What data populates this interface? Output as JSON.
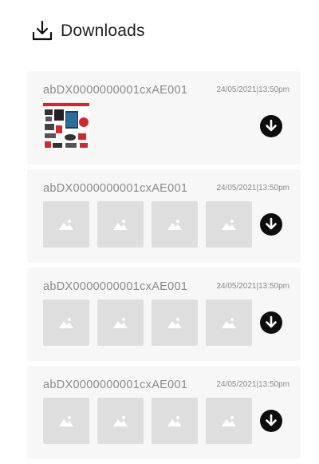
{
  "header": {
    "title": "Downloads",
    "icon": "download-tray-icon"
  },
  "cards": [
    {
      "id": "abDX0000000001cxAE001",
      "date": "24/05/2021|13:50pm",
      "thumbs": [
        "product-flyer-image"
      ]
    },
    {
      "id": "abDX0000000001cxAE001",
      "date": "24/05/2021|13:50pm",
      "thumbs": [
        "image-placeholder",
        "image-placeholder",
        "image-placeholder",
        "image-placeholder"
      ]
    },
    {
      "id": "abDX0000000001cxAE001",
      "date": "24/05/2021|13:50pm",
      "thumbs": [
        "image-placeholder",
        "image-placeholder",
        "image-placeholder",
        "image-placeholder"
      ]
    },
    {
      "id": "abDX0000000001cxAE001",
      "date": "24/05/2021|13:50pm",
      "thumbs": [
        "image-placeholder",
        "image-placeholder",
        "image-placeholder",
        "image-placeholder"
      ]
    }
  ],
  "colors": {
    "placeholder": "#dedede",
    "card_bg": "#f7f7f7",
    "button": "#0d0d0d",
    "flyer_accent": "#d7262b"
  }
}
